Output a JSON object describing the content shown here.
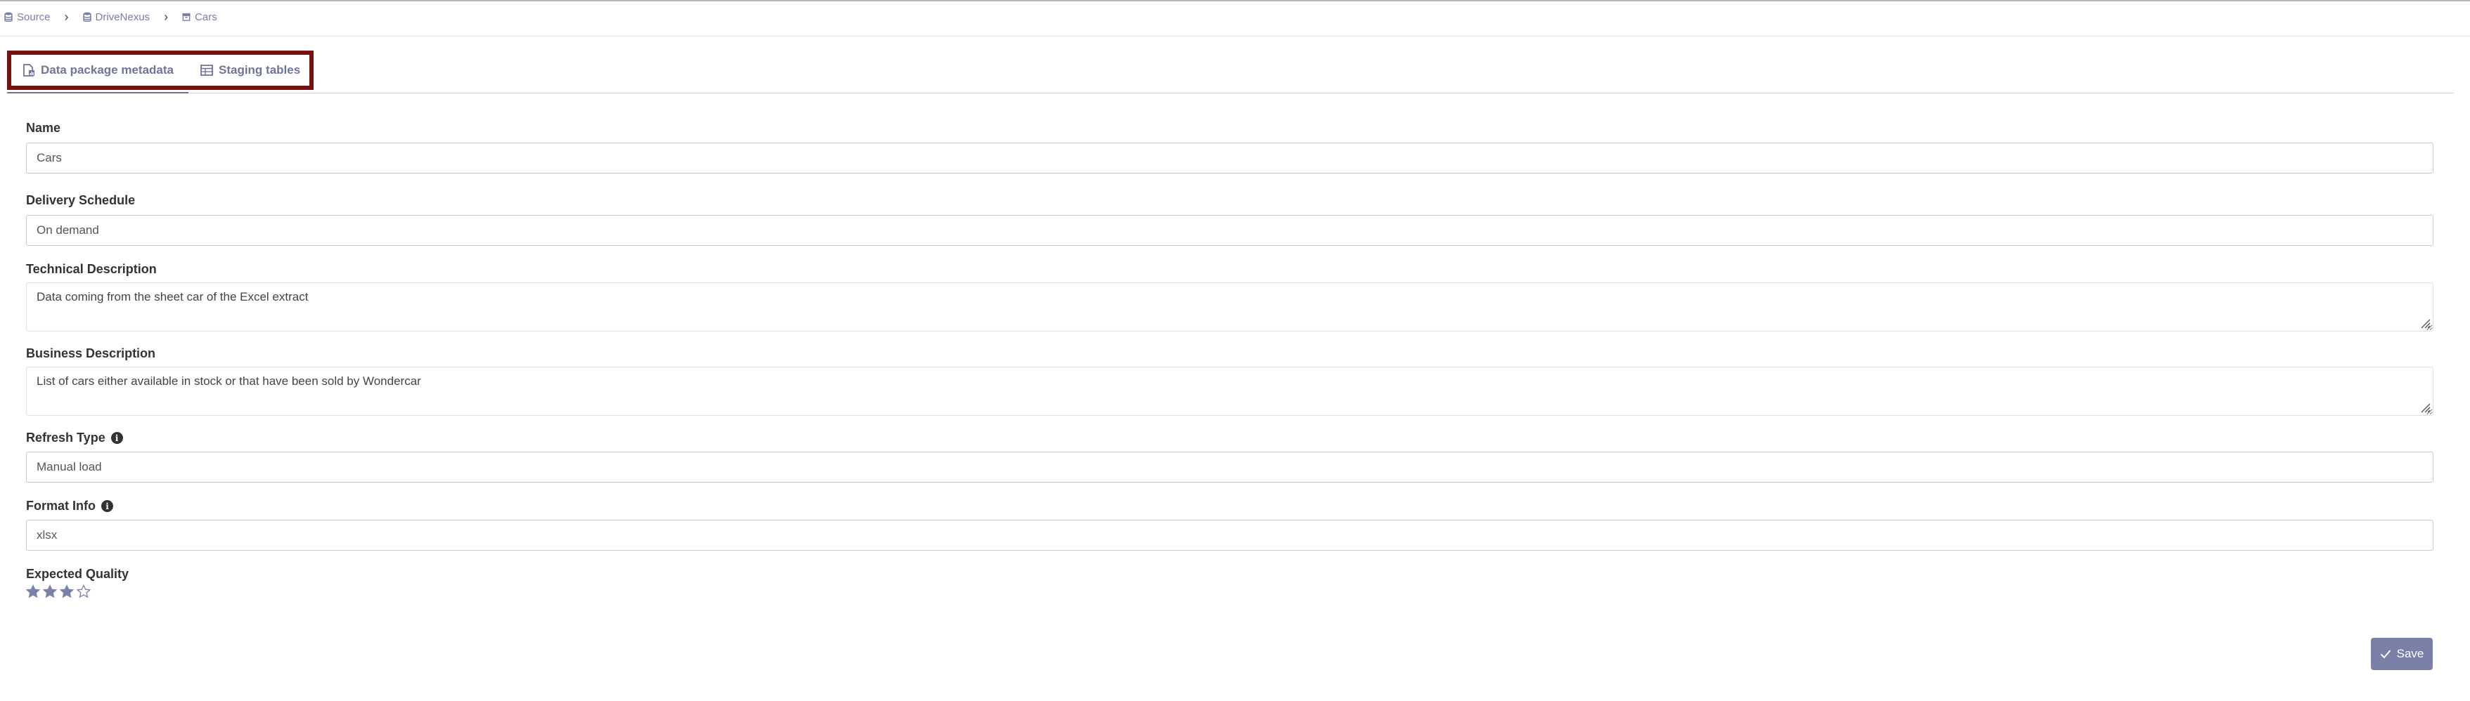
{
  "breadcrumb": {
    "items": [
      {
        "label": "Source",
        "icon": "database-icon"
      },
      {
        "label": "DriveNexus",
        "icon": "database-icon"
      },
      {
        "label": "Cars",
        "icon": "archive-icon"
      }
    ],
    "separator": "›"
  },
  "tabs": [
    {
      "label": "Data package metadata",
      "icon": "file-chart-icon",
      "active": true
    },
    {
      "label": "Staging tables",
      "icon": "table-icon",
      "active": false
    }
  ],
  "form": {
    "name": {
      "label": "Name",
      "value": "Cars"
    },
    "delivery_schedule": {
      "label": "Delivery Schedule",
      "value": "On demand"
    },
    "technical_description": {
      "label": "Technical Description",
      "value": "Data coming from the sheet car of the Excel extract"
    },
    "business_description": {
      "label": "Business Description",
      "value": "List of cars either available in stock or that have been sold by Wondercar"
    },
    "refresh_type": {
      "label": "Refresh Type",
      "value": "Manual load"
    },
    "format_info": {
      "label": "Format Info",
      "value": "xlsx"
    },
    "expected_quality": {
      "label": "Expected Quality",
      "rating": 3,
      "max": 4
    }
  },
  "actions": {
    "save_label": "Save"
  },
  "colors": {
    "accent": "#7a80a8",
    "highlight_border": "#7a0f12",
    "link": "#7a7fa6"
  }
}
